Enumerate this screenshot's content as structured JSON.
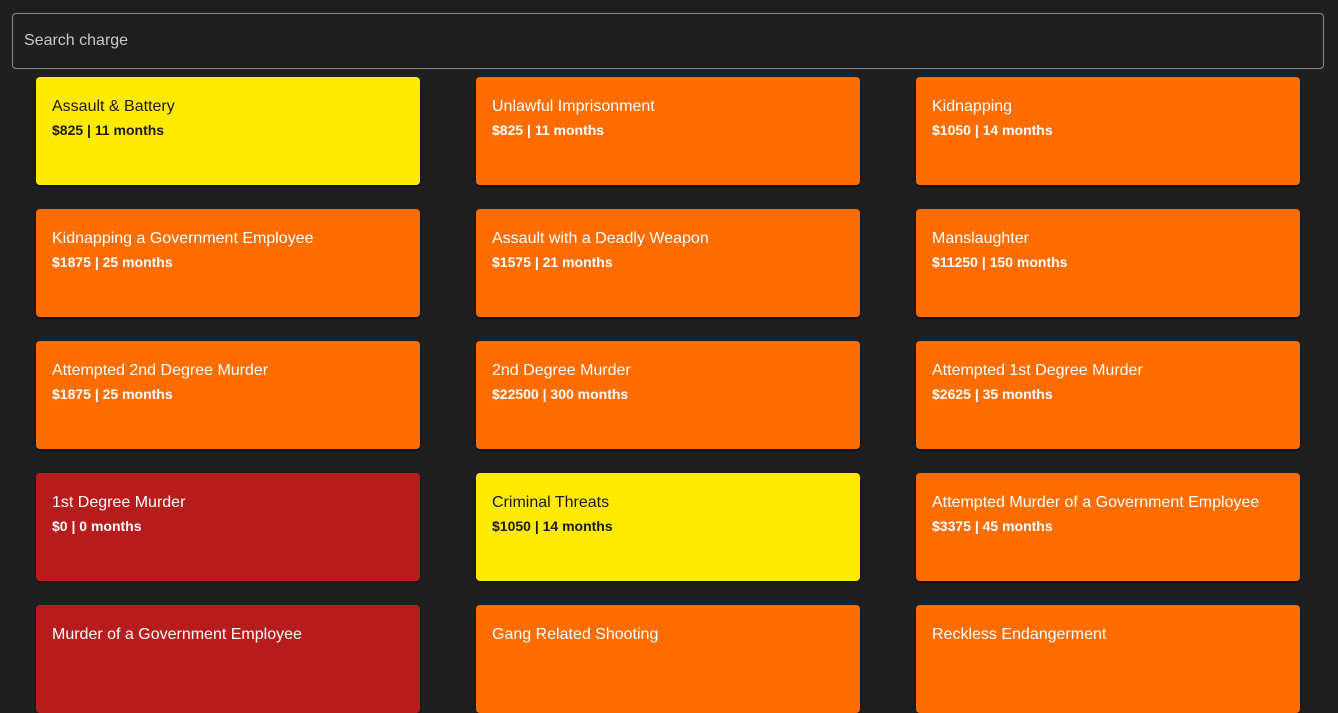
{
  "search": {
    "placeholder": "Search charge",
    "value": ""
  },
  "colors": {
    "background": "#1e1e1e",
    "orange": "#ff6d00",
    "yellow": "#ffea00",
    "red": "#b71c1c"
  },
  "charges": [
    {
      "title": "Assault & Battery",
      "detail": "$825 | 11 months",
      "severity": "yellow"
    },
    {
      "title": "Unlawful Imprisonment",
      "detail": "$825 | 11 months",
      "severity": "orange"
    },
    {
      "title": "Kidnapping",
      "detail": "$1050 | 14 months",
      "severity": "orange"
    },
    {
      "title": "Kidnapping a Government Employee",
      "detail": "$1875 | 25 months",
      "severity": "orange"
    },
    {
      "title": "Assault with a Deadly Weapon",
      "detail": "$1575 | 21 months",
      "severity": "orange"
    },
    {
      "title": "Manslaughter",
      "detail": "$11250 | 150 months",
      "severity": "orange"
    },
    {
      "title": "Attempted 2nd Degree Murder",
      "detail": "$1875 | 25 months",
      "severity": "orange"
    },
    {
      "title": "2nd Degree Murder",
      "detail": "$22500 | 300 months",
      "severity": "orange"
    },
    {
      "title": "Attempted 1st Degree Murder",
      "detail": "$2625 | 35 months",
      "severity": "orange"
    },
    {
      "title": "1st Degree Murder",
      "detail": "$0 | 0 months",
      "severity": "red"
    },
    {
      "title": "Criminal Threats",
      "detail": "$1050 | 14 months",
      "severity": "yellow"
    },
    {
      "title": "Attempted Murder of a Government Employee",
      "detail": "$3375 | 45 months",
      "severity": "orange"
    },
    {
      "title": "Murder of a Government Employee",
      "detail": "",
      "severity": "red"
    },
    {
      "title": "Gang Related Shooting",
      "detail": "",
      "severity": "orange"
    },
    {
      "title": "Reckless Endangerment",
      "detail": "",
      "severity": "orange"
    }
  ]
}
